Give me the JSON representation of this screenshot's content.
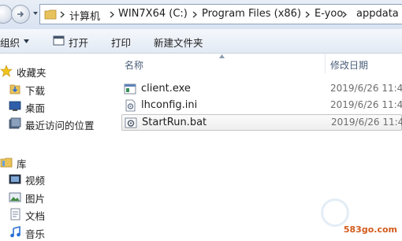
{
  "address": {
    "crumbs": [
      "计算机",
      "WIN7X64 (C:)",
      "Program Files (x86)",
      "E-yoo",
      "appdata"
    ]
  },
  "toolbar": {
    "organize_label": "组织",
    "open_label": "打开",
    "print_label": "打印",
    "new_folder_label": "新建文件夹"
  },
  "sidebar": {
    "favorites_header": "收藏夹",
    "favorites": [
      {
        "label": "下载",
        "icon": "download-folder-icon"
      },
      {
        "label": "桌面",
        "icon": "desktop-icon"
      },
      {
        "label": "最近访问的位置",
        "icon": "recent-places-icon"
      }
    ],
    "libraries_header": "库",
    "libraries": [
      {
        "label": "视频",
        "icon": "videos-library-icon"
      },
      {
        "label": "图片",
        "icon": "pictures-library-icon"
      },
      {
        "label": "文档",
        "icon": "documents-library-icon"
      },
      {
        "label": "音乐",
        "icon": "music-library-icon"
      }
    ]
  },
  "file_list": {
    "columns": {
      "name": "名称",
      "date_modified": "修改日期"
    },
    "files": [
      {
        "name": "client.exe",
        "date": "2019/6/26 11:4",
        "icon": "exe-file-icon"
      },
      {
        "name": "lhconfig.ini",
        "date": "2019/6/26 11:4",
        "icon": "ini-file-icon"
      },
      {
        "name": "StartRun.bat",
        "date": "2019/6/26 11:4",
        "icon": "bat-file-icon",
        "selected": true
      }
    ]
  },
  "watermark": "583go.com",
  "colors": {
    "selection_border": "#c5c5c5",
    "watermark": "#d35b1c",
    "column_header": "#4c607a"
  }
}
